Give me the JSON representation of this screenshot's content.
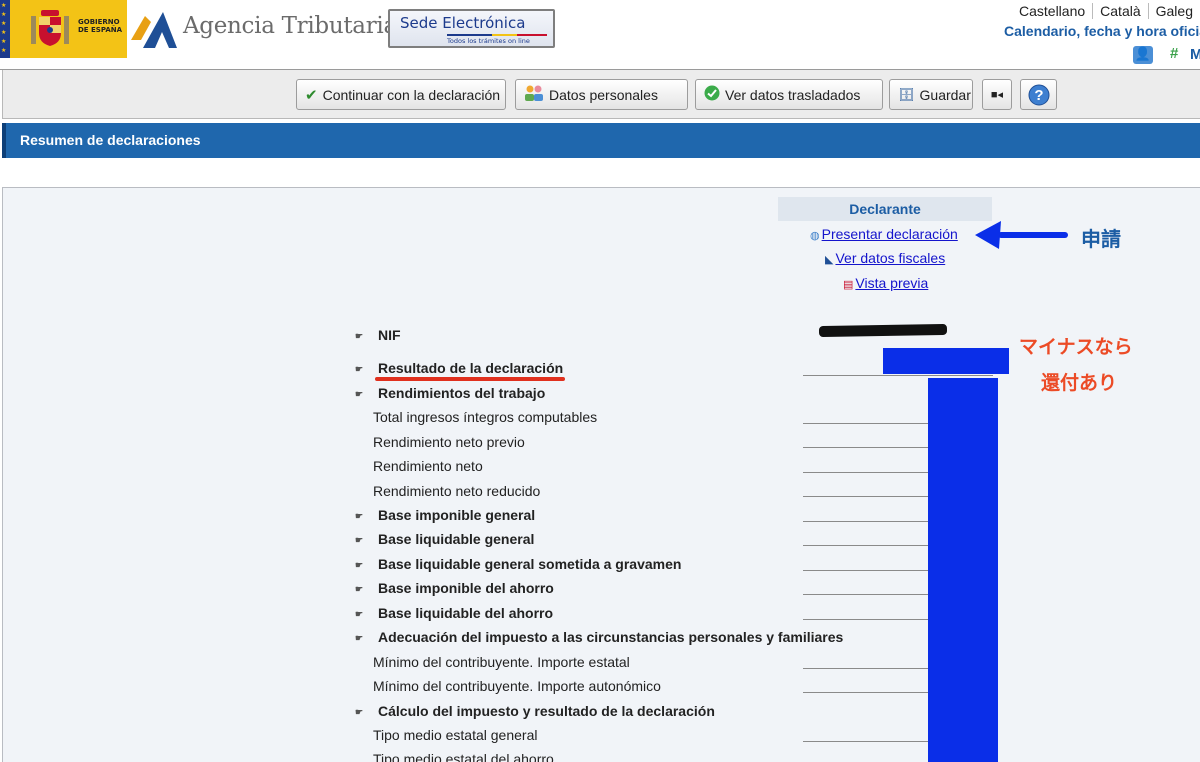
{
  "header": {
    "gobierno_text": [
      "GOBIERNO",
      "DE ESPAÑA"
    ],
    "agency_name": "Agencia Tributaria",
    "sede_title": "Sede Electrónica",
    "sede_subtitle": "Todos los trámites on line",
    "languages": [
      "Castellano",
      "Català",
      "Galeg"
    ],
    "calendar_link": "Calendario, fecha y hora oficia",
    "hash_label": "#",
    "m_label": "M"
  },
  "toolbar": {
    "buttons": [
      {
        "label": "Continuar con la declaración",
        "icon": "check-icon"
      },
      {
        "label": "Datos personales",
        "icon": "people-icon"
      },
      {
        "label": "Ver datos trasladados",
        "icon": "green-check-icon"
      },
      {
        "label": "Guardar",
        "icon": "save-icon"
      },
      {
        "label": "",
        "icon": "video-icon"
      },
      {
        "label": "",
        "icon": "help-icon"
      }
    ]
  },
  "title_bar": {
    "title": "Resumen de declaraciones"
  },
  "declarant": {
    "header": "Declarante",
    "links": [
      {
        "label": "Presentar declaración",
        "icon": "globe-icon"
      },
      {
        "label": "Ver datos fiscales",
        "icon": "at-logo-icon"
      },
      {
        "label": "Vista previa",
        "icon": "pdf-icon"
      }
    ]
  },
  "rows": [
    {
      "label": "NIF",
      "bold": true,
      "hand": true,
      "line": false
    },
    {
      "label": "Resultado de la declaración",
      "bold": true,
      "hand": true,
      "line": true
    },
    {
      "label": "Rendimientos del trabajo",
      "bold": true,
      "hand": true,
      "line": false
    },
    {
      "label": "Total ingresos íntegros computables",
      "bold": false,
      "hand": false,
      "line": true
    },
    {
      "label": "Rendimiento neto previo",
      "bold": false,
      "hand": false,
      "line": true
    },
    {
      "label": "Rendimiento neto",
      "bold": false,
      "hand": false,
      "line": true
    },
    {
      "label": "Rendimiento neto reducido",
      "bold": false,
      "hand": false,
      "line": true
    },
    {
      "label": "Base imponible general",
      "bold": true,
      "hand": true,
      "line": true
    },
    {
      "label": "Base liquidable general",
      "bold": true,
      "hand": true,
      "line": true
    },
    {
      "label": "Base liquidable general sometida a gravamen",
      "bold": true,
      "hand": true,
      "line": true
    },
    {
      "label": "Base imponible del ahorro",
      "bold": true,
      "hand": true,
      "line": true
    },
    {
      "label": "Base liquidable del ahorro",
      "bold": true,
      "hand": true,
      "line": true
    },
    {
      "label": "Adecuación del impuesto a las circunstancias personales y familiares",
      "bold": true,
      "hand": true,
      "line": false
    },
    {
      "label": "Mínimo del contribuyente. Importe estatal",
      "bold": false,
      "hand": false,
      "line": true
    },
    {
      "label": "Mínimo del contribuyente. Importe autonómico",
      "bold": false,
      "hand": false,
      "line": true
    },
    {
      "label": "Cálculo del impuesto y resultado de la declaración",
      "bold": true,
      "hand": true,
      "line": false
    },
    {
      "label": "Tipo medio estatal general",
      "bold": false,
      "hand": false,
      "line": true
    },
    {
      "label": "Tipo medio estatal del ahorro",
      "bold": false,
      "hand": false,
      "line": true
    }
  ],
  "annotations": {
    "apply_note": "申請",
    "minus_note": "マイナスなら",
    "refund_note": "還付あり",
    "note_colors": {
      "blue": "#1c5da4",
      "red": "#ec4b26",
      "redaction_blue": "#0a2ee8"
    }
  }
}
